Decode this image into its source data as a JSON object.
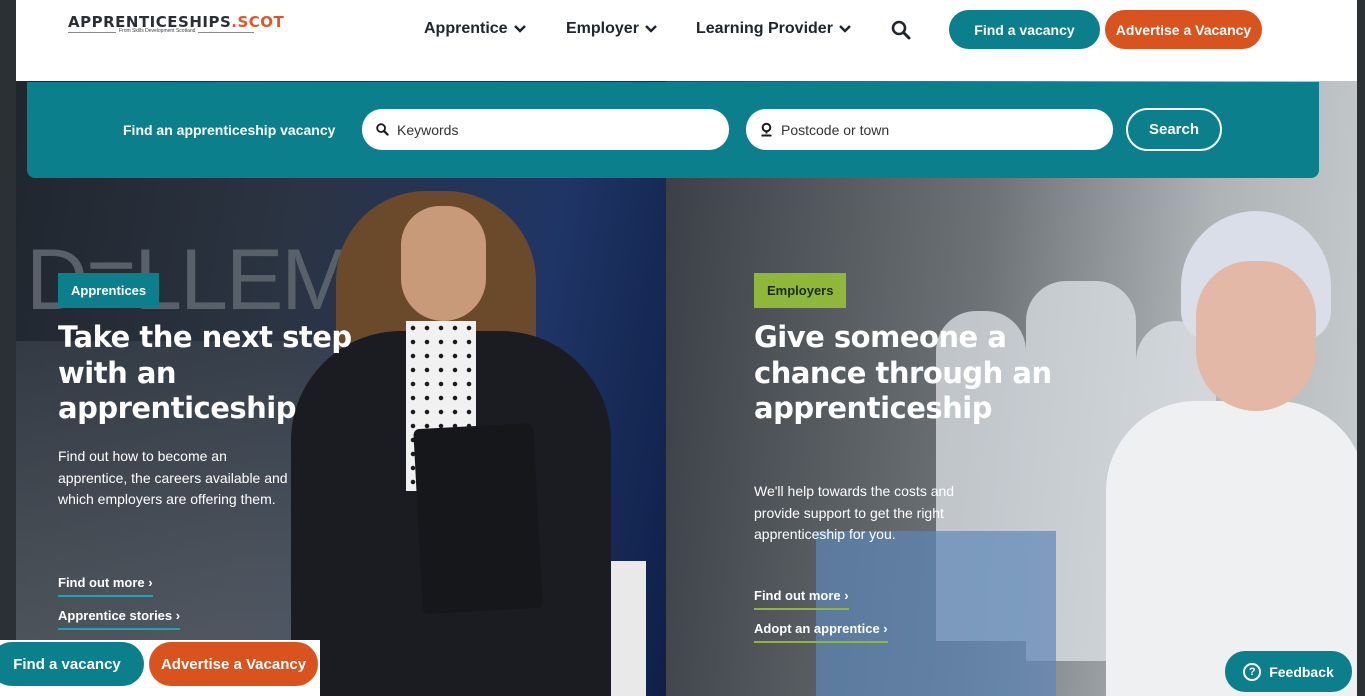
{
  "header": {
    "logo": {
      "main": "APPRENTICESHIPS",
      "dot": ".",
      "suffix": "SCOT",
      "tagline": "From Skills Development Scotland"
    },
    "nav": [
      {
        "label": "Apprentice"
      },
      {
        "label": "Employer"
      },
      {
        "label": "Learning Provider"
      }
    ],
    "find_vacancy": "Find a vacancy",
    "advertise_vacancy": "Advertise a Vacancy"
  },
  "search": {
    "label": "Find an apprenticeship vacancy",
    "keywords_placeholder": "Keywords",
    "postcode_placeholder": "Postcode or town",
    "button": "Search"
  },
  "hero": {
    "background_text": "D≡LLEMC",
    "apprentices": {
      "tag": "Apprentices",
      "heading": "Take the next step with an apprenticeship",
      "text": "Find out how to become an apprentice, the careers available and which employers are offering them.",
      "links": [
        "Find out more ›",
        "Apprentice stories ›"
      ]
    },
    "employers": {
      "tag": "Employers",
      "heading": "Give someone a chance through an apprenticeship",
      "text": "We'll help towards the costs and provide support to get the right apprenticeship for you.",
      "links": [
        "Find out more ›",
        "Adopt an apprentice ›"
      ]
    }
  },
  "sticky": {
    "find_vacancy": "Find a vacancy",
    "advertise_vacancy": "Advertise a Vacancy"
  },
  "feedback": {
    "icon_char": "?",
    "label": "Feedback"
  },
  "colors": {
    "teal": "#0b7f8c",
    "orange": "#d9531e",
    "green": "#8fb83b",
    "dark": "#2b3035"
  }
}
